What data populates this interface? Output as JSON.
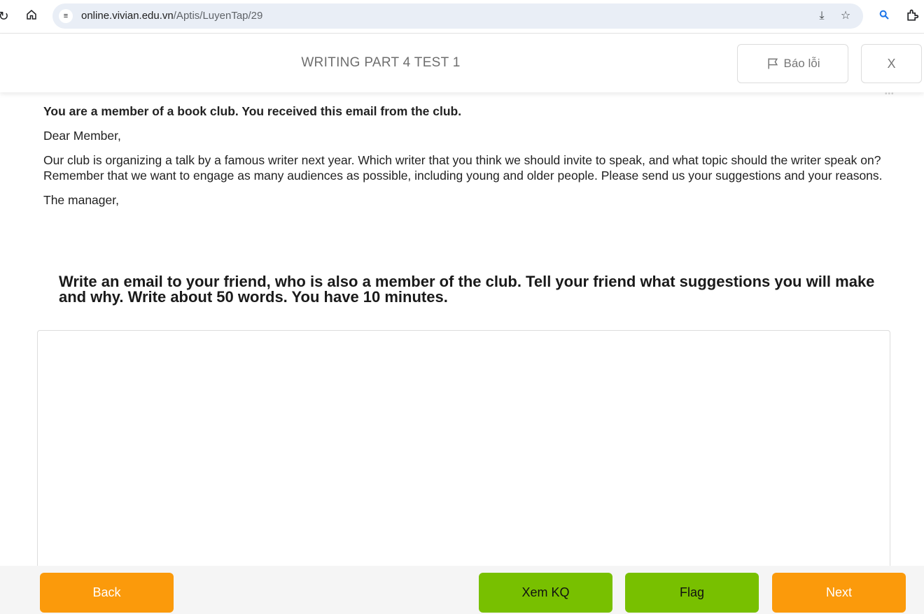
{
  "browser": {
    "url_host": "online.vivian.edu.vn",
    "url_path": "/Aptis/LuyenTap/29",
    "icons": [
      "reload-icon",
      "home-icon",
      "site-settings-icon",
      "install-app-icon",
      "bookmark-star-icon",
      "search-lens-icon",
      "extensions-icon"
    ]
  },
  "header": {
    "title": "WRITING PART 4 TEST 1",
    "report_label": "Báo lỗi",
    "close_label": "X"
  },
  "question": {
    "intro": "You are a member of a book club. You received this email from the club.",
    "greeting": "Dear Member,",
    "body": "Our club is organizing a talk by a famous writer next year. Which writer that you think we should invite to speak, and what topic should the writer speak on? Remember that we want to engage as many audiences as possible, including young and older people. Please send us your suggestions and your reasons.",
    "signoff": "The manager,",
    "task": "Write an email to your friend, who is also a member of the club. Tell your friend what suggestions you will make and why. Write about 50 words. You have 10 minutes."
  },
  "answer": {
    "value": "",
    "placeholder": ""
  },
  "footer": {
    "back_label": "Back",
    "result_label": "Xem KQ",
    "flag_label": "Flag",
    "next_label": "Next"
  },
  "colors": {
    "orange": "#fb9a0b",
    "green": "#78c000"
  }
}
